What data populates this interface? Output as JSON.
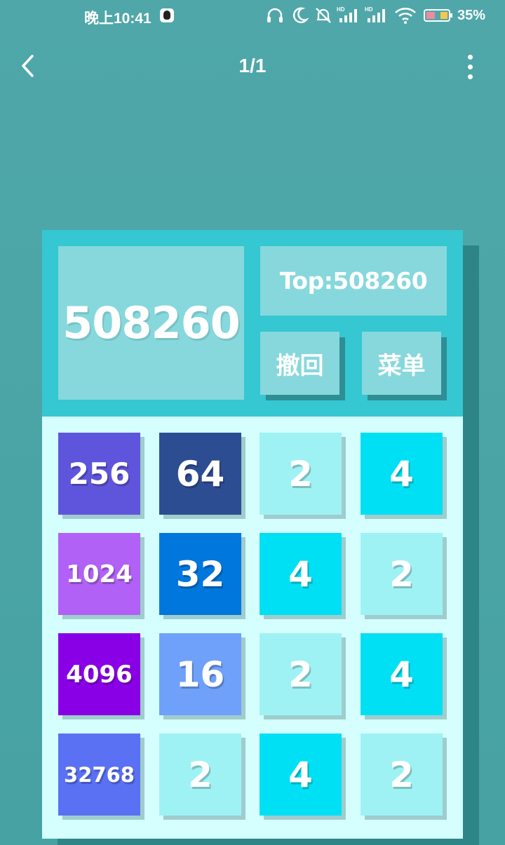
{
  "status_bar": {
    "time": "晚上10:41",
    "battery": "35%"
  },
  "nav": {
    "title": "1/1",
    "back_icon": "chevron-left-icon",
    "more_icon": "more-vertical-icon"
  },
  "game": {
    "score": "508260",
    "top_label": "Top:508260",
    "undo_label": "撤回",
    "menu_label": "菜单",
    "board": [
      [
        {
          "value": "256",
          "color": "#5f55dc"
        },
        {
          "value": "64",
          "color": "#2d4d93"
        },
        {
          "value": "2",
          "color": "#9ff2f4"
        },
        {
          "value": "4",
          "color": "#00e0f4"
        }
      ],
      [
        {
          "value": "1024",
          "color": "#b161f5"
        },
        {
          "value": "32",
          "color": "#0077dd"
        },
        {
          "value": "4",
          "color": "#00e0f4"
        },
        {
          "value": "2",
          "color": "#9ff2f4"
        }
      ],
      [
        {
          "value": "4096",
          "color": "#8a00e6"
        },
        {
          "value": "16",
          "color": "#70a1fa"
        },
        {
          "value": "2",
          "color": "#9ff2f4"
        },
        {
          "value": "4",
          "color": "#00e0f4"
        }
      ],
      [
        {
          "value": "32768",
          "color": "#5a71f4"
        },
        {
          "value": "2",
          "color": "#9ff2f4"
        },
        {
          "value": "4",
          "color": "#00e0f4"
        },
        {
          "value": "2",
          "color": "#9ff2f4"
        }
      ]
    ]
  }
}
